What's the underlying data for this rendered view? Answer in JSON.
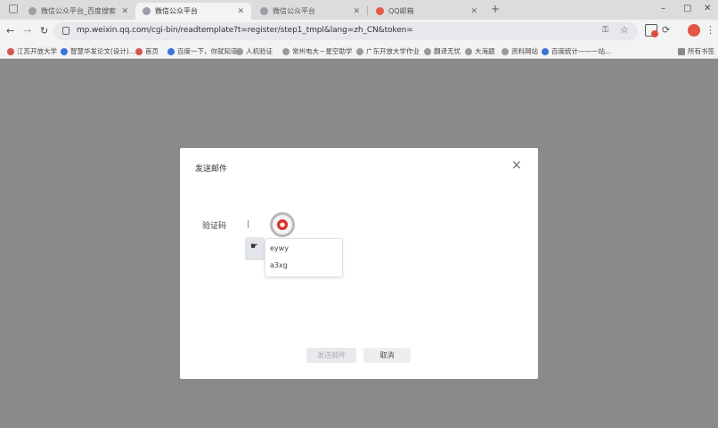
{
  "browser": {
    "tabs": [
      {
        "title": "微信公众平台_百度搜索",
        "active": false
      },
      {
        "title": "微信公众平台",
        "active": true
      },
      {
        "title": "微信公众平台",
        "active": false
      },
      {
        "title": "QQ邮箱",
        "active": false
      }
    ],
    "url": "mp.weixin.qq.com/cgi-bin/readtemplate?t=register/step1_tmpl&lang=zh_CN&token=",
    "window_controls": {
      "minimize": "–",
      "restore": "▢",
      "close": "✕"
    }
  },
  "bookmarks": [
    "江苏开放大学",
    "智慧华发论文(设计)...",
    "首页",
    "百度一下，你就知道",
    "人机验证",
    "常州电大－星空助学",
    "广东开放大学作业",
    "翻译无忧",
    "大海题",
    "资料网站",
    "百度统计——一站...",
    "所有书签"
  ],
  "dialog": {
    "title": "发送邮件",
    "field_label": "验证码",
    "suggestions": [
      "eywy",
      "a3xg"
    ],
    "send_button": "发送邮件",
    "cancel_button": "取消"
  },
  "colors": {
    "overlay": "#8a8a8a",
    "record_dot": "#d93025"
  }
}
